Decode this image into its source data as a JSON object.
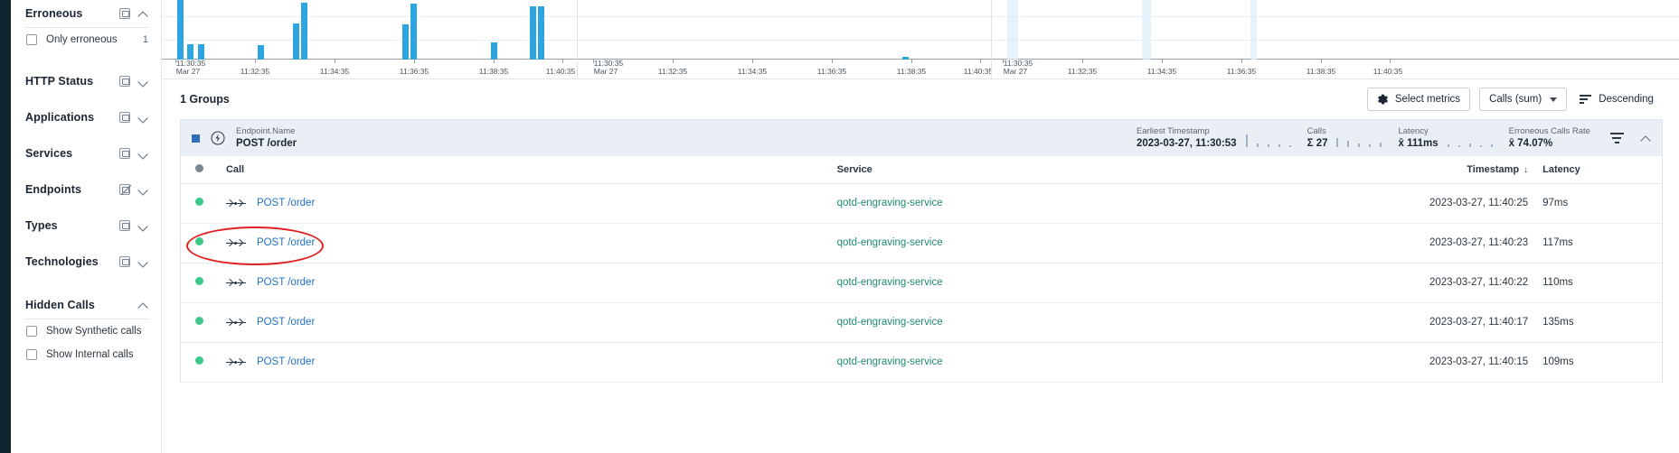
{
  "sidebar": {
    "sections": [
      {
        "title": "Erroneous",
        "icon": "chart-card-icon",
        "chevron": "chevron-up-icon",
        "expanded": true
      },
      {
        "title": "HTTP Status",
        "icon": "chart-card-icon",
        "chevron": "chevron-down-icon",
        "expanded": false
      },
      {
        "title": "Applications",
        "icon": "chart-card-icon",
        "chevron": "chevron-down-icon",
        "expanded": false
      },
      {
        "title": "Services",
        "icon": "chart-card-icon",
        "chevron": "chevron-down-icon",
        "expanded": false
      },
      {
        "title": "Endpoints",
        "icon": "chart-card-disabled-icon",
        "chevron": "chevron-down-icon",
        "expanded": false
      },
      {
        "title": "Types",
        "icon": "chart-card-icon",
        "chevron": "chevron-down-icon",
        "expanded": false
      },
      {
        "title": "Technologies",
        "icon": "chart-card-icon",
        "chevron": "chevron-down-icon",
        "expanded": false
      },
      {
        "title": "Hidden Calls",
        "icon": "",
        "chevron": "chevron-up-icon",
        "expanded": true
      }
    ],
    "erroneous": {
      "checkbox_label": "Only erroneous",
      "count": "1",
      "checked": false
    },
    "hidden_calls": [
      {
        "label": "Show Synthetic calls",
        "checked": false
      },
      {
        "label": "Show Internal calls",
        "checked": false
      }
    ]
  },
  "toolbar": {
    "groups_count": "1 Groups",
    "select_metrics_label": "Select metrics",
    "metric_select_value": "Calls (sum)",
    "sort_label": "Descending",
    "gear_icon": "gear-icon",
    "sort_icon": "sort-descending-icon"
  },
  "group": {
    "color_swatch": "#2f6fb5",
    "endpoint_label": "Endpoint.Name",
    "endpoint_value": "POST /order",
    "earliest_label": "Earliest Timestamp",
    "earliest_value": "2023-03-27, 11:30:53",
    "calls_label": "Calls",
    "calls_value": "27",
    "calls_prefix": "Σ",
    "latency_label": "Latency",
    "latency_value": "111ms",
    "latency_prefix": "x̄",
    "erroneous_label": "Erroneous Calls Rate",
    "erroneous_value": "74.07%",
    "erroneous_prefix": "x̄",
    "filter_icon": "filter-icon",
    "collapse_icon": "chevron-up-icon",
    "bolt_icon": "request-attribute-icon"
  },
  "table": {
    "columns": [
      "",
      "Call",
      "Service",
      "Timestamp",
      "Latency"
    ],
    "sort_column": "Timestamp",
    "sort_dir_glyph": "↓",
    "rows": [
      {
        "status": "ok",
        "call": "POST /order",
        "service": "qotd-engraving-service",
        "timestamp": "2023-03-27, 11:40:25",
        "latency": "97ms",
        "highlighted": false
      },
      {
        "status": "ok",
        "call": "POST /order",
        "service": "qotd-engraving-service",
        "timestamp": "2023-03-27, 11:40:23",
        "latency": "117ms",
        "highlighted": true
      },
      {
        "status": "ok",
        "call": "POST /order",
        "service": "qotd-engraving-service",
        "timestamp": "2023-03-27, 11:40:22",
        "latency": "110ms",
        "highlighted": false
      },
      {
        "status": "ok",
        "call": "POST /order",
        "service": "qotd-engraving-service",
        "timestamp": "2023-03-27, 11:40:17",
        "latency": "135ms",
        "highlighted": false
      },
      {
        "status": "ok",
        "call": "POST /order",
        "service": "qotd-engraving-service",
        "timestamp": "2023-03-27, 11:40:15",
        "latency": "109ms",
        "highlighted": false
      }
    ]
  },
  "chart_data": [
    {
      "type": "bar",
      "title": "",
      "xlabel": "",
      "ylabel": "",
      "grid": true,
      "date_label": "Mar 27",
      "bar_color": "#2ca5e0",
      "tick_labels": [
        "11:30:35",
        "11:32:35",
        "11:34:35",
        "11:36:35",
        "11:38:35",
        "11:40:35"
      ],
      "x": [
        "11:30:35",
        "11:30:55",
        "11:31:10",
        "11:32:35",
        "11:33:20",
        "11:33:35",
        "11:36:50",
        "11:37:05",
        "11:39:20",
        "11:40:10",
        "11:40:20"
      ],
      "values": [
        100,
        26,
        26,
        24,
        60,
        95,
        58,
        92,
        28,
        88,
        88
      ],
      "ylim": [
        0,
        105
      ]
    },
    {
      "type": "bar",
      "title": "",
      "xlabel": "",
      "ylabel": "",
      "grid": true,
      "date_label": "Mar 27",
      "bar_color": "#2ca5e0",
      "tick_labels": [
        "11:30:35",
        "11:32:35",
        "11:34:35",
        "11:36:35",
        "11:38:35",
        "11:40:35"
      ],
      "x": [
        "11:36:30"
      ],
      "values": [
        2
      ],
      "ylim": [
        0,
        105
      ]
    },
    {
      "type": "bar",
      "title": "",
      "xlabel": "",
      "ylabel": "",
      "grid": true,
      "date_label": "Mar 27",
      "bar_color": "#ddeef9",
      "tick_labels": [
        "11:30:35",
        "11:32:35",
        "11:34:35",
        "11:36:35",
        "11:38:35",
        "11:40:35"
      ],
      "x": [
        "11:30:45",
        "11:33:35"
      ],
      "values": [
        100,
        100
      ],
      "ylim": [
        0,
        105
      ]
    }
  ]
}
